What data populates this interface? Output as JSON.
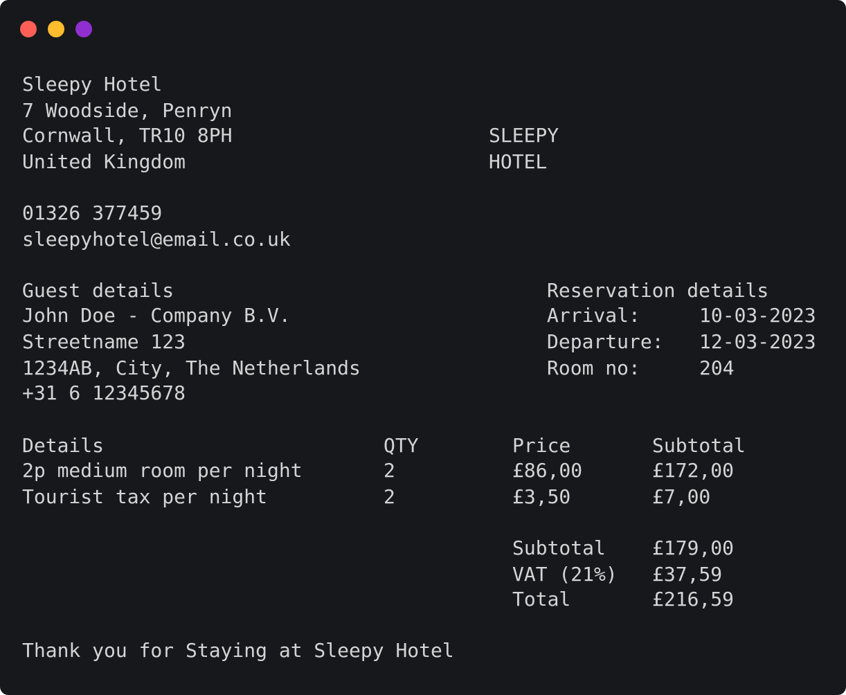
{
  "window": {
    "controls": {
      "close_color": "#ff5f57",
      "minimize_color": "#ffbd2e",
      "zoom_color": "#8f2fd0"
    }
  },
  "hotel": {
    "name": "Sleepy Hotel",
    "address_line1": "7 Woodside, Penryn",
    "address_line2": "Cornwall, TR10 8PH",
    "country": "United Kingdom",
    "phone": "01326 377459",
    "email": "sleepyhotel@email.co.uk",
    "logo_line1": "SLEEPY",
    "logo_line2": "HOTEL"
  },
  "guest": {
    "heading": "Guest details",
    "name": "John Doe - Company B.V.",
    "street": "Streetname 123",
    "city": "1234AB, City, The Netherlands",
    "phone": "+31 6 12345678"
  },
  "reservation": {
    "heading": "Reservation details",
    "arrival_label": "Arrival:",
    "arrival_value": "10-03-2023",
    "departure_label": "Departure:",
    "departure_value": "12-03-2023",
    "room_label": "Room no:",
    "room_value": "204"
  },
  "items": {
    "headers": {
      "details": "Details",
      "qty": "QTY",
      "price": "Price",
      "subtotal": "Subtotal"
    },
    "rows": [
      {
        "details": "2p medium room per night",
        "qty": "2",
        "price": "£86,00",
        "subtotal": "£172,00"
      },
      {
        "details": "Tourist tax per night",
        "qty": "2",
        "price": "£3,50",
        "subtotal": "£7,00"
      }
    ]
  },
  "totals": {
    "subtotal_label": "Subtotal",
    "subtotal_value": "£179,00",
    "vat_label": "VAT (21%)",
    "vat_value": "£37,59",
    "total_label": "Total",
    "total_value": "£216,59"
  },
  "footer": {
    "thanks": "Thank you for Staying at Sleepy Hotel"
  }
}
